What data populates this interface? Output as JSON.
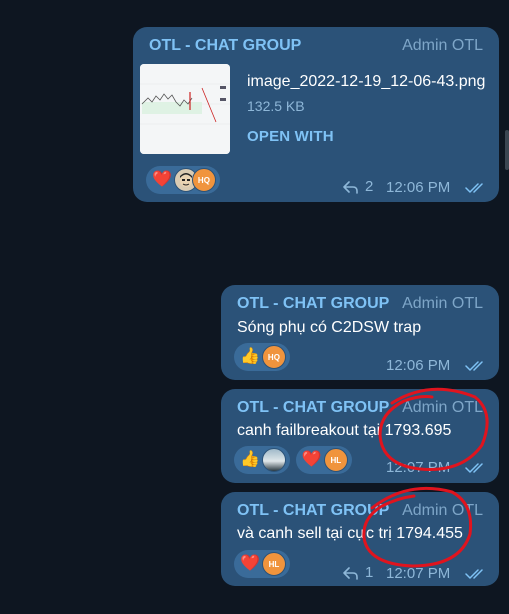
{
  "messages": [
    {
      "sender": "OTL - CHAT GROUP",
      "admin": "Admin OTL",
      "file": {
        "name": "image_2022-12-19_12-06-43.png",
        "size": "132.5 KB",
        "action": "OPEN WITH"
      },
      "reactions": [
        {
          "emoji": "❤️",
          "avatars": [
            "face",
            "HQ"
          ]
        }
      ],
      "replies": "2",
      "time": "12:06 PM"
    },
    {
      "sender": "OTL - CHAT GROUP",
      "admin": "Admin OTL",
      "text": "Sóng phụ có C2DSW trap",
      "reactions": [
        {
          "emoji": "👍",
          "avatars": [
            "HQ"
          ]
        }
      ],
      "time": "12:06 PM"
    },
    {
      "sender": "OTL - CHAT GROUP",
      "admin": "Admin OTL",
      "text": "canh failbreakout tại 1793.695",
      "reactions": [
        {
          "emoji": "👍",
          "avatars": [
            "landscape"
          ]
        },
        {
          "emoji": "❤️",
          "avatars": [
            "HL"
          ]
        }
      ],
      "time": "12:07 PM"
    },
    {
      "sender": "OTL - CHAT GROUP",
      "admin": "Admin OTL",
      "text": "và canh sell tại cực trị 1794.455",
      "reactions": [
        {
          "emoji": "❤️",
          "avatars": [
            "HL"
          ]
        }
      ],
      "replies": "1",
      "time": "12:07 PM"
    }
  ],
  "colors": {
    "background": "#0e1621",
    "bubble": "#2b5278",
    "sender": "#7fc2f5",
    "annotation": "#e0141e",
    "avatar": "#f0943d"
  }
}
